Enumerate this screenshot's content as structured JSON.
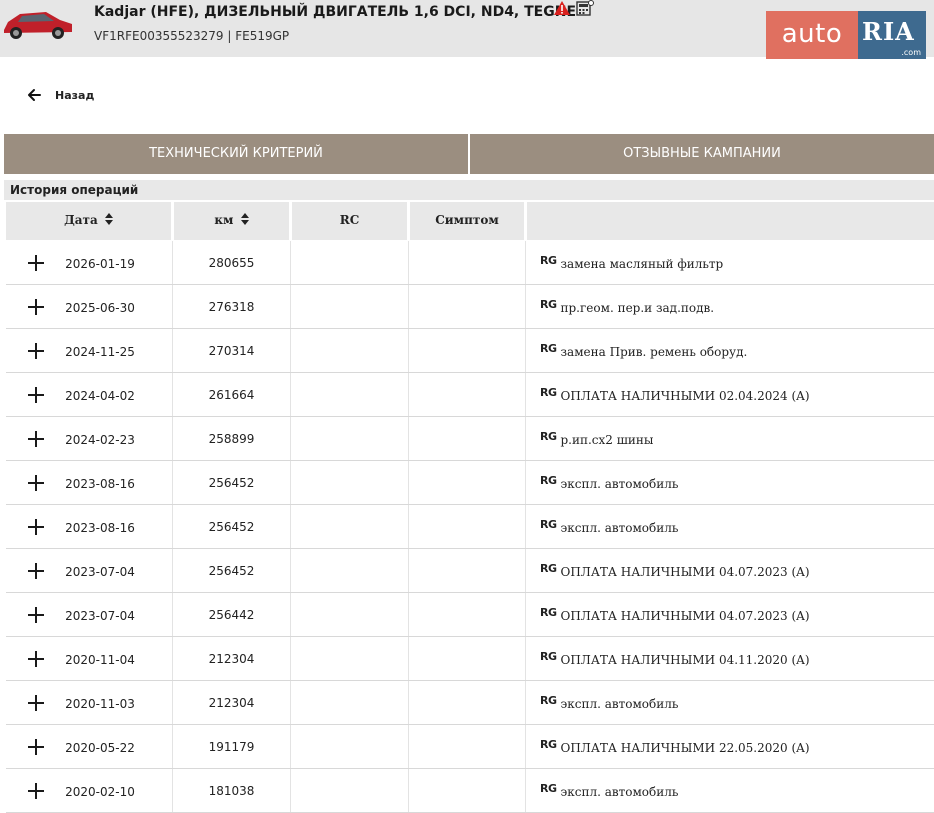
{
  "header": {
    "title": "Kadjar (HFE), ДИЗЕЛЬНЫЙ ДВИГАТЕЛЬ 1,6 DCI, ND4, TEGNE",
    "subtitle": "VF1RFE00355523279 | FE519GP",
    "icons": [
      "car-image",
      "warning-icon",
      "calculator-icon"
    ],
    "logo": {
      "auto": "auto",
      "ria": "RIA",
      "com": ".com"
    }
  },
  "back": {
    "label": "Назад"
  },
  "tabs": [
    {
      "label": "ТЕХНИЧЕСКИЙ КРИТЕРИЙ"
    },
    {
      "label": "ОТЗЫВНЫЕ КАМПАНИИ"
    }
  ],
  "history": {
    "title": "История операций",
    "columns": {
      "date": "Дата",
      "km": "км",
      "rc": "RC",
      "symptom": "Симптом"
    },
    "rows": [
      {
        "date": "2026-01-19",
        "km": "280655",
        "tag": "RG",
        "desc": "замена масляный фильтр"
      },
      {
        "date": "2025-06-30",
        "km": "276318",
        "tag": "RG",
        "desc": "пр.геом. пер.и зад.подв."
      },
      {
        "date": "2024-11-25",
        "km": "270314",
        "tag": "RG",
        "desc": "замена Прив. ремень оборуд."
      },
      {
        "date": "2024-04-02",
        "km": "261664",
        "tag": "RG",
        "desc": "ОПЛАТА НАЛИЧНЫМИ 02.04.2024 (A)"
      },
      {
        "date": "2024-02-23",
        "km": "258899",
        "tag": "RG",
        "desc": "р.ип.сх2 шины"
      },
      {
        "date": "2023-08-16",
        "km": "256452",
        "tag": "RG",
        "desc": "экспл. автомобиль"
      },
      {
        "date": "2023-08-16",
        "km": "256452",
        "tag": "RG",
        "desc": "экспл. автомобиль"
      },
      {
        "date": "2023-07-04",
        "km": "256452",
        "tag": "RG",
        "desc": "ОПЛАТА НАЛИЧНЫМИ 04.07.2023 (A)"
      },
      {
        "date": "2023-07-04",
        "km": "256442",
        "tag": "RG",
        "desc": "ОПЛАТА НАЛИЧНЫМИ 04.07.2023 (A)"
      },
      {
        "date": "2020-11-04",
        "km": "212304",
        "tag": "RG",
        "desc": "ОПЛАТА НАЛИЧНЫМИ 04.11.2020 (A)"
      },
      {
        "date": "2020-11-03",
        "km": "212304",
        "tag": "RG",
        "desc": "экспл. автомобиль"
      },
      {
        "date": "2020-05-22",
        "km": "191179",
        "tag": "RG",
        "desc": "ОПЛАТА НАЛИЧНЫМИ 22.05.2020 (A)"
      },
      {
        "date": "2020-02-10",
        "km": "181038",
        "tag": "RG",
        "desc": "экспл. автомобиль"
      }
    ]
  }
}
